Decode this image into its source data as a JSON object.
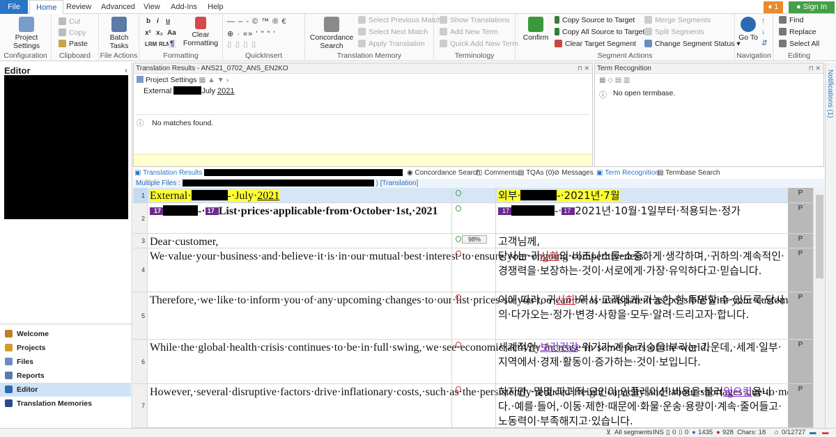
{
  "tabs": {
    "file": "File",
    "home": "Home",
    "review": "Review",
    "advanced": "Advanced",
    "view": "View",
    "addins": "Add-Ins",
    "help": "Help"
  },
  "notif_count": "1",
  "signin": "Sign In",
  "ribbon": {
    "configuration": {
      "label": "Configuration",
      "project_settings": "Project Settings"
    },
    "clipboard": {
      "label": "Clipboard",
      "cut": "Cut",
      "copy": "Copy",
      "paste": "Paste"
    },
    "file_actions": {
      "label": "File Actions",
      "batch_tasks": "Batch Tasks"
    },
    "formatting": {
      "label": "Formatting",
      "clear_formatting": "Clear Formatting"
    },
    "quickinsert": {
      "label": "QuickInsert",
      "row1": "— – ‑ © ™ ® € ",
      "row2": "⊕ · «» ' \" \" '"
    },
    "translation_memory": {
      "label": "Translation Memory",
      "concordance": "Concordance Search",
      "prev_match": "Select Previous Match",
      "next_match": "Select Next Match",
      "apply": "Apply Translation"
    },
    "terminology": {
      "label": "Terminology",
      "show": "Show Translations",
      "add_term": "Add New Term",
      "quick_add": "Quick Add New Term"
    },
    "segment_actions": {
      "label": "Segment Actions",
      "confirm": "Confirm",
      "copy_src": "Copy Source to Target",
      "copy_all": "Copy All Source to Target",
      "clear_tgt": "Clear Target Segment",
      "merge": "Merge Segments",
      "split": "Split Segments",
      "change_status": "Change Segment Status"
    },
    "navigation": {
      "label": "Navigation",
      "goto": "Go To"
    },
    "editing": {
      "label": "Editing",
      "find": "Find",
      "replace": "Replace",
      "select_all": "Select All"
    }
  },
  "left": {
    "title": "Editor",
    "nav": [
      {
        "label": "Welcome",
        "color": "#c47a2a"
      },
      {
        "label": "Projects",
        "color": "#d49a2a"
      },
      {
        "label": "Files",
        "color": "#6a8cbf"
      },
      {
        "label": "Reports",
        "color": "#5a7aa8"
      },
      {
        "label": "Editor",
        "color": "#2a6ab0"
      },
      {
        "label": "Translation Memories",
        "color": "#2a4a8a"
      }
    ]
  },
  "tr": {
    "title": "Translation Results - ANS21_0702_ANS_EN2KO",
    "project_settings": "Project Settings",
    "src_a": "External",
    "src_b": "July",
    "src_c": "2021",
    "no_matches": "No matches found."
  },
  "term": {
    "title": "Term Recognition",
    "msg": "No open termbase."
  },
  "notifications": "Notifications (1)",
  "midtabs": {
    "tr": "Translation Results",
    "conc": "Concordance Search",
    "comments": "Comments",
    "tqas": "TQAs (0)",
    "messages": "Messages",
    "termrec": "Term Recognition",
    "termsearch": "Termbase Search"
  },
  "filebar": {
    "multi": "Multiple Files",
    "trans": ") [Translation]"
  },
  "segments": [
    {
      "n": "1",
      "src_a": "External·",
      "src_b": "-·July·",
      "src_c": "2021",
      "tgt_a": "외부·",
      "tgt_b": "-·2021년·7월",
      "p": "P"
    },
    {
      "n": "2",
      "tag": "17",
      "src": "List·prices·applicable·from·October·1st,·2021",
      "tgt": "2021년·10월·1일부터·적용되는·정가",
      "p": "P"
    },
    {
      "n": "3",
      "src": "Dear·customer,",
      "pct": "98%",
      "tgt": "고객님께,",
      "p": "P"
    },
    {
      "n": "4",
      "src": "We·value·your·business·and·believe·it·is·in·our·mutual·best·interest·to·ensure·your·ongoing·competitiveness.",
      "tgt_a": "당사는·귀",
      "tgt_e": "사하",
      "tgt_b": "의·비즈니스를·소중하게·생각하며,·귀하의·계속적인·경쟁력을·보장하는·것이·서로에게·가장·유익하다고·믿습니다.",
      "p": "P"
    },
    {
      "n": "5",
      "src": "Therefore,·we·like·to·inform·you·of·any·upcoming·changes·to·our·list·prices·so·you·too·can·be·as·transparent·as·possible·with·your·customers.",
      "tgt_a": "이에·따라,·귀",
      "tgt_e": "사하",
      "tgt_b": "·역시·고객에게·가능한·한·투명할·수·있도록·당사의·다가오는·정가·변경·사항을·모두·알려·드리고자·합니다.",
      "p": "P"
    },
    {
      "n": "6",
      "src": "While·the·global·health·crisis·continues·to·be·in·full·swing,·we·see·economic·activity·increase·in·some·parts·of·the·world.",
      "tgt_a": "세계적인·",
      "tgt_e": "보건건강",
      "tgt_b": "·위기가·계속·기승을·부리는·가운데,·세계·일부·지역에서·경제·활동이·증가하는·것이·보입니다.",
      "p": "P"
    },
    {
      "n": "7",
      "src": "However,·several·disruptive·factors·drive·inflationary·costs,·such·as·the·persistently·reduced·freight·capacity·and·labour·shortages·due·to·movement·restrictions.",
      "tgt_a": "하지만,·몇몇·파괴적·요인이·인플레이션·비용을·불러",
      "tgt_e": "일으킵",
      "tgt_b": "옵니다.·예를·들어,·이동·제한·때문에·화물·운송·용량이·계속·줄어들고·노동력이·부족해지고·있습니다.",
      "p": "P"
    }
  ],
  "status": {
    "all": "All segments",
    "ins": "INS",
    "a": "0",
    "b": "0",
    "c": "1435",
    "d": "928",
    "chars": "Chars: 18",
    "prog": "0/12727"
  }
}
